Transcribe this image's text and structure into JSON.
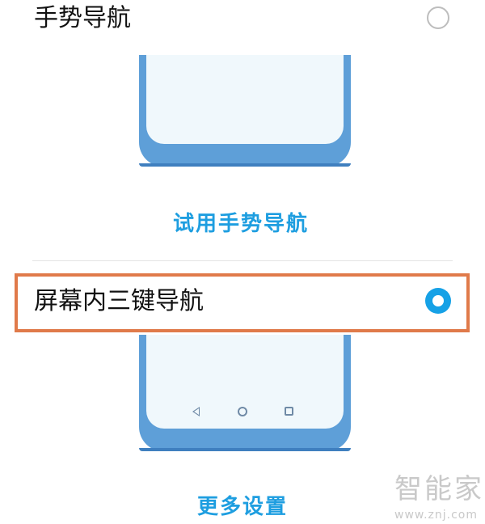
{
  "options": [
    {
      "label": "手势导航",
      "selected": false
    },
    {
      "label": "屏幕内三键导航",
      "selected": true
    }
  ],
  "gesture_try_link": "试用手势导航",
  "more_settings_link": "更多设置",
  "watermark": {
    "brand": "智能家",
    "url": "www.znj.com"
  },
  "colors": {
    "accent": "#16a1e6",
    "link": "#1e9ee0",
    "phone": "#5e9fd8",
    "highlight": "#e07a4a"
  },
  "icons": {
    "nav_back": "triangle-back-icon",
    "nav_home": "circle-home-icon",
    "nav_recent": "square-recent-icon"
  }
}
